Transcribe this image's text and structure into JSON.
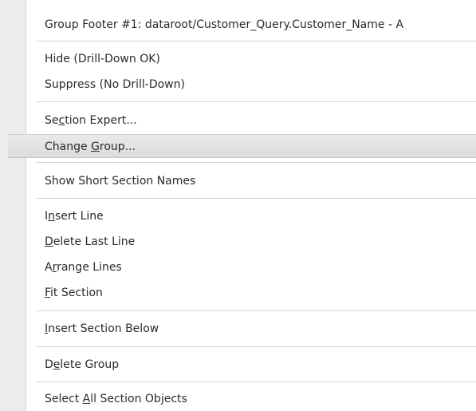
{
  "menu": {
    "header": "Group Footer #1: dataroot/Customer_Query.Customer_Name - A",
    "hide": {
      "pre": "Hide (Drill-Down OK)",
      "key": "",
      "post": ""
    },
    "suppress": {
      "pre": "Suppress (No Drill-Down)",
      "key": "",
      "post": ""
    },
    "section_expert": {
      "pre": "Se",
      "key": "c",
      "post": "tion Expert..."
    },
    "change_group": {
      "pre": "Change ",
      "key": "G",
      "post": "roup..."
    },
    "show_short": {
      "pre": "Show Short Section Names",
      "key": "",
      "post": ""
    },
    "insert_line": {
      "pre": "I",
      "key": "n",
      "post": "sert Line"
    },
    "delete_last_line": {
      "pre": "",
      "key": "D",
      "post": "elete Last Line"
    },
    "arrange_lines": {
      "pre": "A",
      "key": "r",
      "post": "range Lines"
    },
    "fit_section": {
      "pre": "",
      "key": "F",
      "post": "it Section"
    },
    "insert_section_below": {
      "pre": "",
      "key": "I",
      "post": "nsert Section Below"
    },
    "delete_group": {
      "pre": "D",
      "key": "e",
      "post": "lete Group"
    },
    "select_all": {
      "pre": "Select ",
      "key": "A",
      "post": "ll Section Objects"
    }
  }
}
